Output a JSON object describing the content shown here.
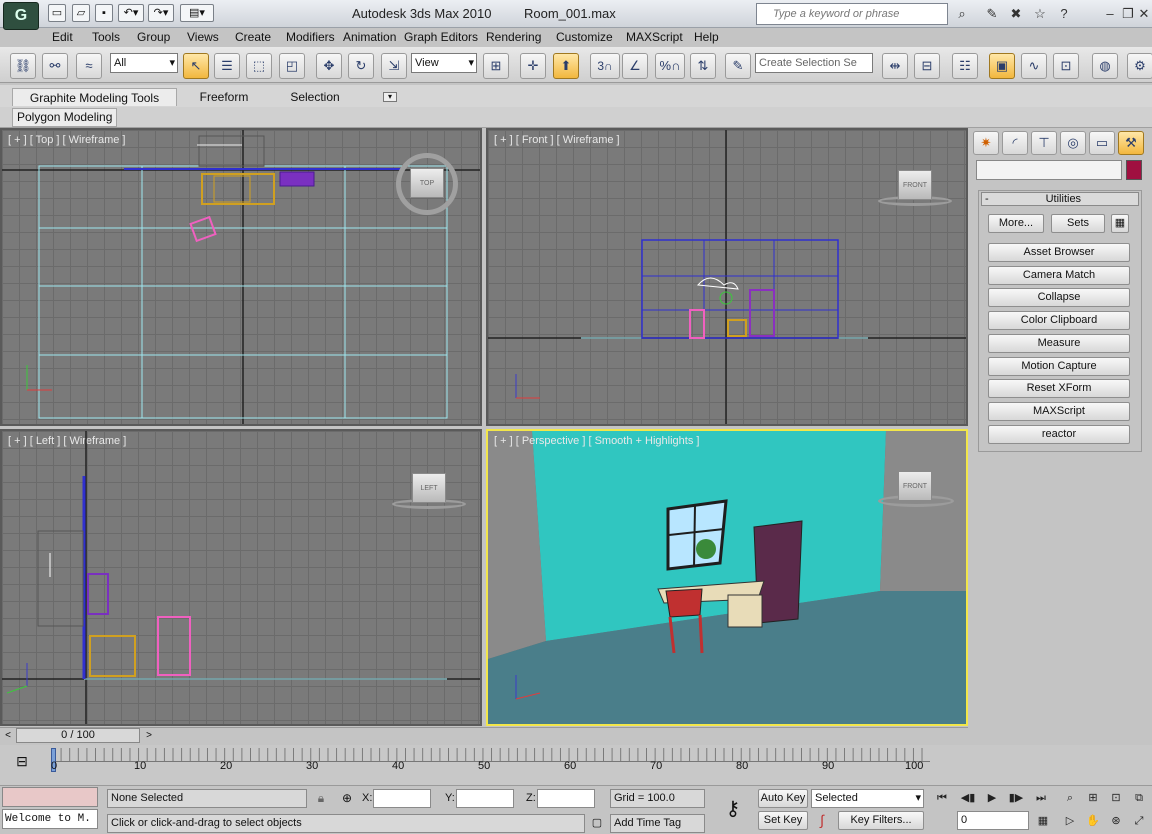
{
  "window": {
    "app_title": "Autodesk 3ds Max  2010",
    "file_name": "Room_001.max",
    "search_placeholder": "Type a keyword or phrase"
  },
  "menus": [
    "Edit",
    "Tools",
    "Group",
    "Views",
    "Create",
    "Modifiers",
    "Animation",
    "Graph Editors",
    "Rendering",
    "Customize",
    "MAXScript",
    "Help"
  ],
  "toolbar": {
    "selection_filter": "All",
    "ref_coord": "View",
    "named_selection_placeholder": "Create Selection Se",
    "angle_snap": "3",
    "percent_snap": "%"
  },
  "ribbon": {
    "tabs": [
      "Graphite Modeling Tools",
      "Freeform",
      "Selection"
    ],
    "panel": "Polygon Modeling"
  },
  "viewports": {
    "top": {
      "label": "[ + ] [ Top ] [ Wireframe ]",
      "cube": "TOP"
    },
    "front": {
      "label": "[ + ] [ Front ] [ Wireframe ]",
      "cube": "FRONT"
    },
    "left": {
      "label": "[ + ] [ Left ] [ Wireframe ]",
      "cube": "LEFT"
    },
    "perspective": {
      "label": "[ + ] [ Perspective ] [ Smooth + Highlights ]",
      "cube": "FRONT"
    }
  },
  "command_panel": {
    "rollout_title": "Utilities",
    "more_label": "More...",
    "sets_label": "Sets",
    "utilities": [
      "Asset Browser",
      "Camera Match",
      "Collapse",
      "Color Clipboard",
      "Measure",
      "Motion Capture",
      "Reset XForm",
      "MAXScript",
      "reactor"
    ]
  },
  "timeline": {
    "frame_display": "0 / 100",
    "ticks": [
      "0",
      "10",
      "20",
      "30",
      "40",
      "50",
      "60",
      "70",
      "80",
      "90",
      "100"
    ]
  },
  "status": {
    "listener": "Welcome to M.",
    "selection": "None Selected",
    "prompt": "Click or click-and-drag to select objects",
    "x_label": "X:",
    "y_label": "Y:",
    "z_label": "Z:",
    "grid": "Grid = 100.0",
    "add_time_tag": "Add Time Tag",
    "auto_key": "Auto Key",
    "set_key": "Set Key",
    "key_mode": "Selected",
    "key_filters": "Key Filters...",
    "current_frame": "0"
  }
}
